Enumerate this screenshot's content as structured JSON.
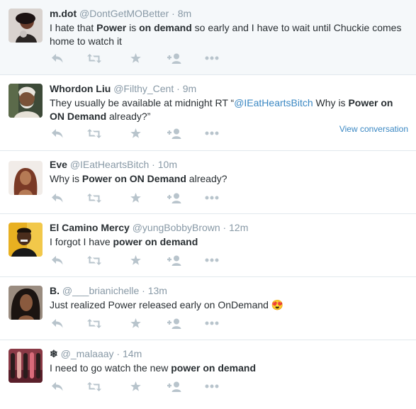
{
  "colors": {
    "accent": "#3b88c3",
    "muted": "#8899a6",
    "action": "#b8c4cc",
    "divider": "#e1e8ed"
  },
  "tweets": [
    {
      "fullname": "m.dot",
      "handle": "@DontGetMOBetter",
      "sep": " · ",
      "time": "8m",
      "text": [
        {
          "t": "I hate that "
        },
        {
          "t": "Power",
          "b": true
        },
        {
          "t": " is "
        },
        {
          "t": "on demand",
          "b": true
        },
        {
          "t": " so early and I have to wait until Chuckie comes home to watch it"
        }
      ]
    },
    {
      "fullname": "Whordon Liu",
      "handle": "@Filthy_Cent",
      "sep": " · ",
      "time": "9m",
      "text": [
        {
          "t": "They usually be available at midnight RT “"
        },
        {
          "t": "@IEatHeartsBitch",
          "m": true
        },
        {
          "t": " Why is "
        },
        {
          "t": "Power on ON Demand",
          "b": true
        },
        {
          "t": " already?”"
        }
      ],
      "view_conversation": "View conversation"
    },
    {
      "fullname": "Eve",
      "handle": "@IEatHeartsBitch",
      "sep": " · ",
      "time": "10m",
      "text": [
        {
          "t": "Why is "
        },
        {
          "t": "Power on ON Demand",
          "b": true
        },
        {
          "t": " already?"
        }
      ]
    },
    {
      "fullname": "El Camino Mercy",
      "handle": "@yungBobbyBrown",
      "sep": " · ",
      "time": "12m",
      "text": [
        {
          "t": "I forgot I have "
        },
        {
          "t": "power on demand",
          "b": true
        }
      ]
    },
    {
      "fullname": "B.",
      "handle": "@___brianichelle",
      "sep": " · ",
      "time": "13m",
      "text": [
        {
          "t": "Just realized Power released early on OnDemand "
        },
        {
          "t": "😍"
        }
      ]
    },
    {
      "fullname": "❄",
      "handle": "@_malaaay",
      "sep": " · ",
      "time": "14m",
      "text": [
        {
          "t": "I need to go watch the new "
        },
        {
          "t": "power on demand",
          "b": true
        }
      ]
    }
  ],
  "action_icons": [
    "reply-icon",
    "retweet-icon",
    "favorite-icon",
    "follow-icon",
    "more-icon"
  ]
}
